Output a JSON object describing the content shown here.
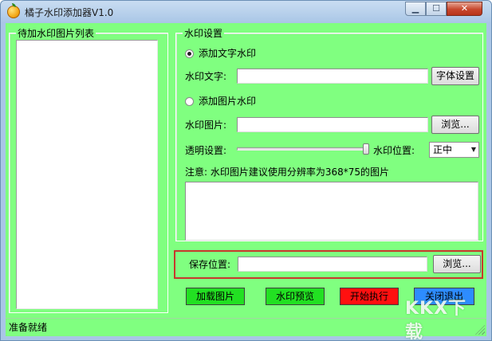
{
  "window": {
    "title": "橘子水印添加器V1.0",
    "controls": {
      "minimize": "▁",
      "maximize": "☐",
      "close": "✕"
    }
  },
  "left_panel": {
    "title": "待加水印图片列表"
  },
  "watermark_settings": {
    "title": "水印设置",
    "text_mode_label": "添加文字水印",
    "text_mode_selected": true,
    "watermark_text_label": "水印文字:",
    "watermark_text_value": "",
    "font_settings_button": "字体设置",
    "image_mode_label": "添加图片水印",
    "image_mode_selected": false,
    "watermark_image_label": "水印图片:",
    "watermark_image_value": "",
    "browse_button": "浏览...",
    "opacity_label": "透明设置:",
    "opacity_value": 1.0,
    "position_label": "水印位置:",
    "position_value": "正中",
    "note": "注意: 水印图片建议使用分辨率为368*75的图片",
    "log_text": ""
  },
  "save": {
    "label": "保存位置:",
    "value": "",
    "browse_button": "浏览..."
  },
  "actions": {
    "load_images": "加载图片",
    "preview": "水印预览",
    "start": "开始执行",
    "exit": "关闭退出"
  },
  "colors": {
    "client_bg": "#80ff80",
    "load_btn": "#22e022",
    "preview_btn": "#22e022",
    "start_btn": "#ff1010",
    "exit_btn": "#2d8cff",
    "highlight_frame": "#c8382c"
  },
  "status_bar": {
    "text": "准备就绪"
  },
  "overlay": {
    "watermark_logo": "KKX下载"
  }
}
